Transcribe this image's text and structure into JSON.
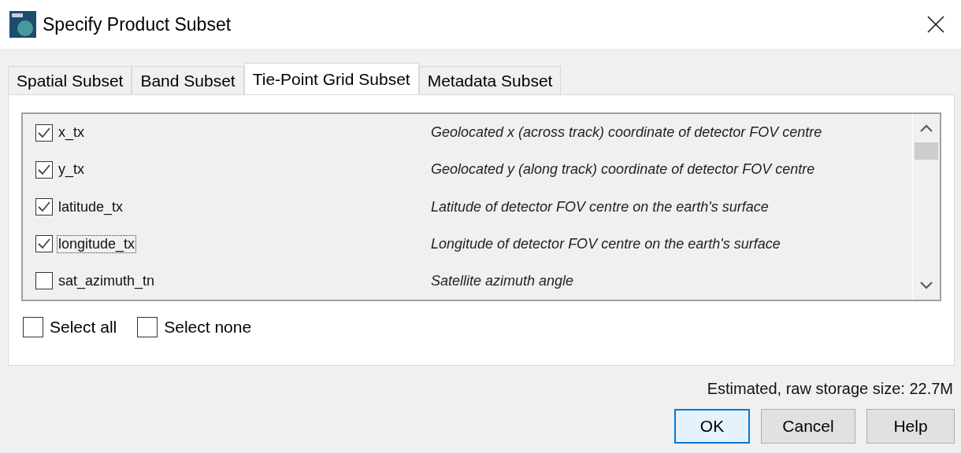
{
  "window": {
    "title": "Specify Product Subset"
  },
  "tabs": [
    {
      "label": "Spatial Subset",
      "selected": false
    },
    {
      "label": "Band Subset",
      "selected": false
    },
    {
      "label": "Tie-Point Grid Subset",
      "selected": true
    },
    {
      "label": "Metadata Subset",
      "selected": false
    }
  ],
  "grids": [
    {
      "name": "x_tx",
      "description": "Geolocated x (across track) coordinate of detector FOV centre",
      "checked": true,
      "focused": false
    },
    {
      "name": "y_tx",
      "description": "Geolocated y (along track) coordinate of detector FOV centre",
      "checked": true,
      "focused": false
    },
    {
      "name": "latitude_tx",
      "description": "Latitude of detector FOV centre on the earth's surface",
      "checked": true,
      "focused": false
    },
    {
      "name": "longitude_tx",
      "description": "Longitude of detector FOV centre on the earth's surface",
      "checked": true,
      "focused": true
    },
    {
      "name": "sat_azimuth_tn",
      "description": "Satellite azimuth angle",
      "checked": false,
      "focused": false
    }
  ],
  "selection": [
    {
      "label": "Select all",
      "checked": false
    },
    {
      "label": "Select none",
      "checked": false
    }
  ],
  "storage_size": "Estimated, raw storage size: 22.7M",
  "buttons": [
    {
      "label": "OK",
      "default": true
    },
    {
      "label": "Cancel",
      "default": false
    },
    {
      "label": "Help",
      "default": false
    }
  ]
}
